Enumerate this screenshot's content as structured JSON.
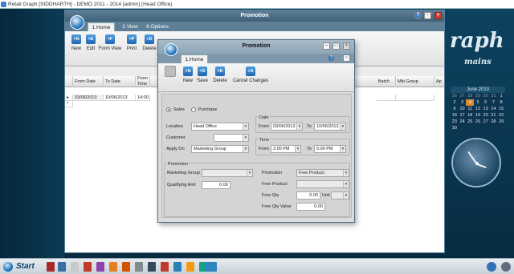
{
  "main_title": "Retail Graph [SIDDHARTH] - DEMO  2011 - 2014 [admin] (Head Office)",
  "brand": {
    "title": "raph",
    "subtitle": "mains"
  },
  "promotion_window": {
    "title": "Promotion",
    "tabs": [
      "1.Home",
      "2.View",
      "6.Options"
    ],
    "ribbon": [
      "New",
      "Edit",
      "Form View",
      "Print",
      "Delete"
    ],
    "ribbon_icons": [
      "new-icon",
      "edit-icon",
      "form-view-icon",
      "print-icon",
      "delete-icon"
    ],
    "grid": {
      "headers": [
        "From Date",
        "To Date",
        "From Time",
        "Batch",
        "Mkt Group",
        "Ap"
      ],
      "rows": [
        {
          "from_date": "03/06/2013",
          "to_date": "10/06/2013",
          "from_time": "14:00"
        }
      ],
      "new_row_marker": "*"
    }
  },
  "dialog": {
    "title": "Promotion",
    "tab": "1.Home",
    "ribbon": [
      "New",
      "Save",
      "Delete",
      "Cancel Changes"
    ],
    "ribbon_icons": [
      "new-icon",
      "save-icon",
      "delete-icon",
      "cancel-changes-icon"
    ],
    "radio": {
      "sales": "Sales",
      "purchase": "Purchase",
      "selected": "Sales"
    },
    "location_label": "Location",
    "location_value": "Head Office",
    "customer_label": "Customer",
    "customer_value": "",
    "apply_on_label": "Apply On",
    "apply_on_value": "Marketing Group",
    "date_group": "Date",
    "date_from_label": "From",
    "date_from": "03/06/2013",
    "date_to_label": "To",
    "date_to": "10/06/2013",
    "time_group": "Time",
    "time_from_label": "From",
    "time_from": "2:00 PM",
    "time_to_label": "To",
    "time_to": "5:00 PM",
    "promotion_group": "Promotion",
    "marketing_group_label": "Marketing Group",
    "marketing_group_value": "",
    "qualifying_amt_label": "Qualifying Amt",
    "qualifying_amt": "0.00",
    "promotion_label": "Promotion",
    "promotion_value": "Free Product",
    "free_product_label": "Free Product",
    "free_product_value": "",
    "free_qty_label": "Free Qty",
    "free_qty": "0.00",
    "unit_label": "Unit",
    "unit_value": "",
    "free_qty_value_label": "Free Qty Value",
    "free_qty_value": "0.00"
  },
  "calendar": {
    "month": "June 2013",
    "days": [
      "26",
      "27",
      "28",
      "29",
      "30",
      "31",
      "1",
      "2",
      "3",
      "4",
      "5",
      "6",
      "7",
      "8",
      "9",
      "10",
      "11",
      "12",
      "13",
      "14",
      "15",
      "16",
      "17",
      "18",
      "19",
      "20",
      "21",
      "22",
      "23",
      "24",
      "25",
      "26",
      "27",
      "28",
      "29",
      "30"
    ],
    "today": "4"
  },
  "taskbar": {
    "start_label": "Start"
  }
}
